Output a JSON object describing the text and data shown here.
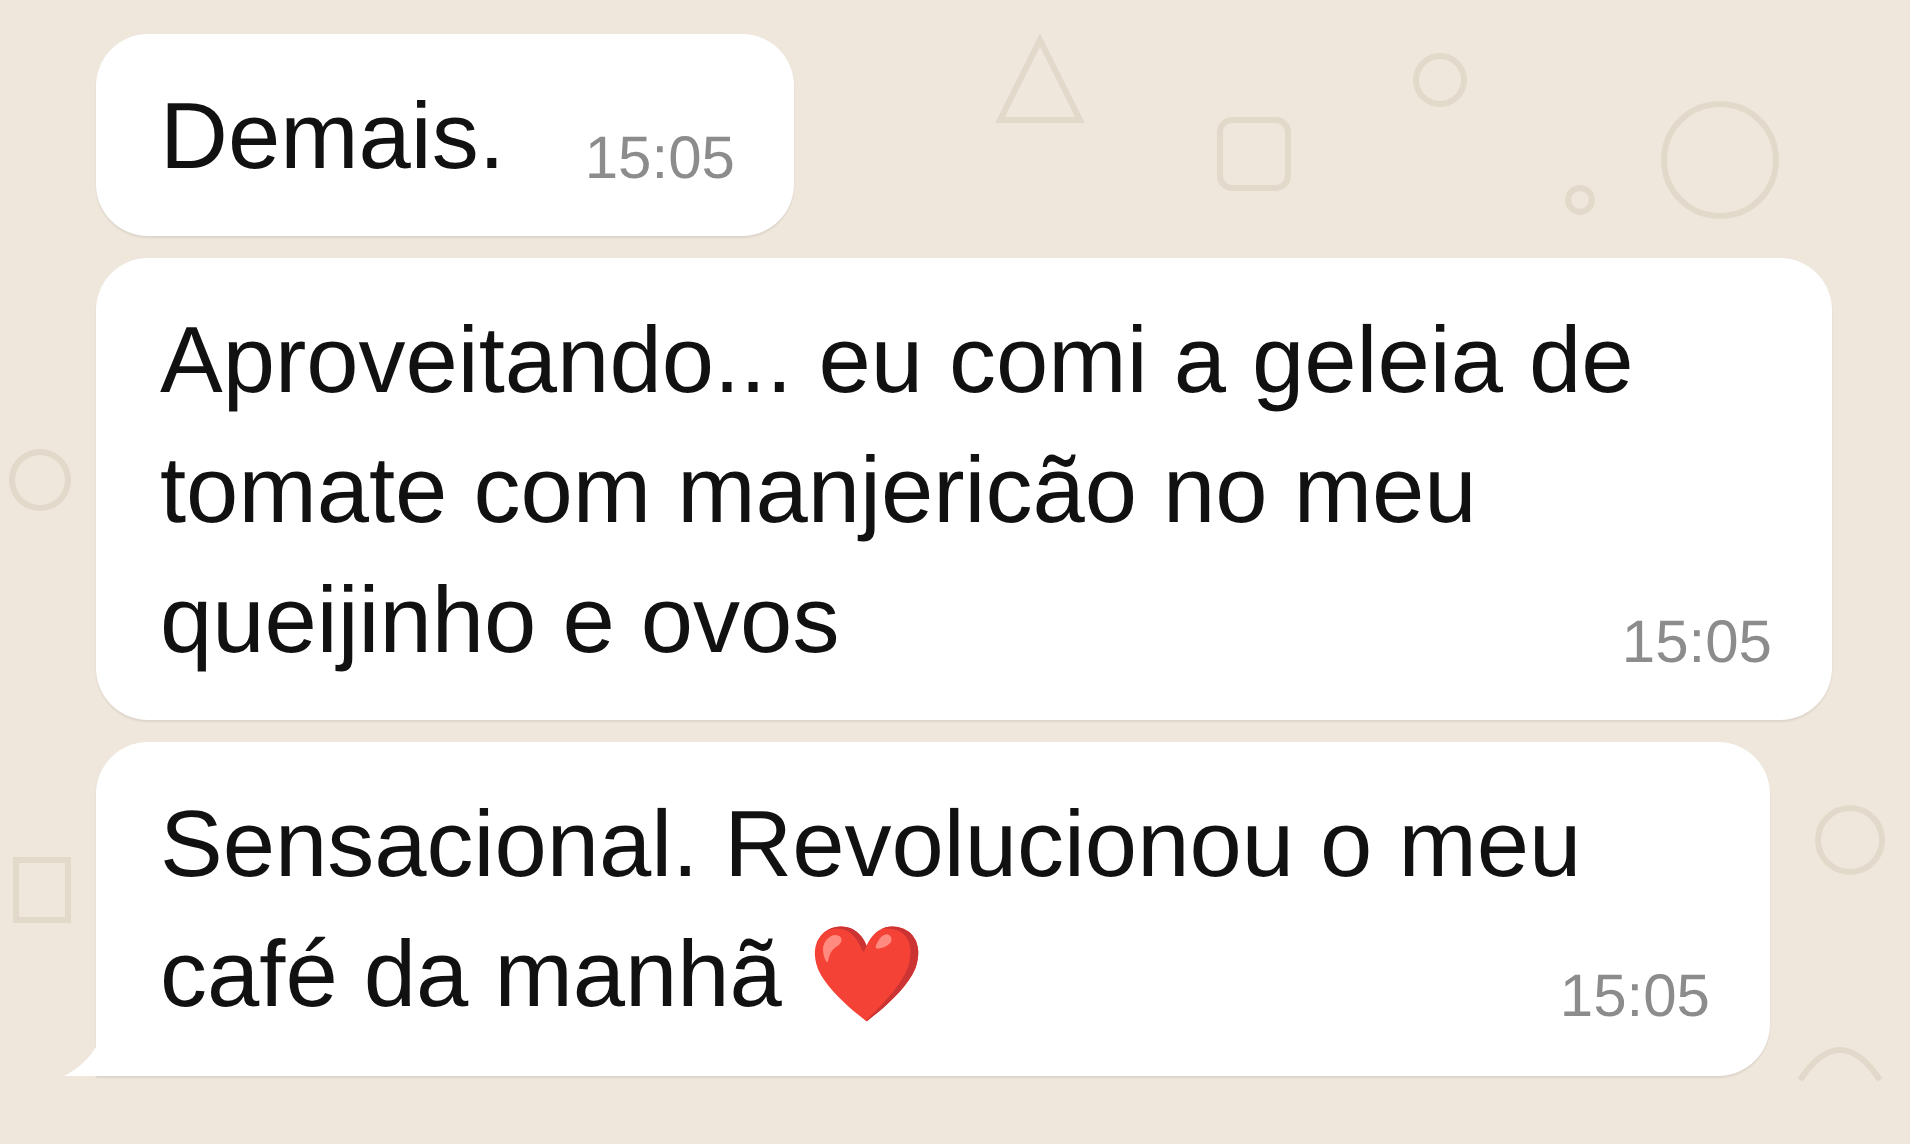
{
  "messages": [
    {
      "text": "Demais.",
      "time": "15:05",
      "tail": false
    },
    {
      "text": "Aproveitando... eu comi a geleia de tomate com manjericão no meu queijinho e ovos",
      "time": "15:05",
      "tail": false
    },
    {
      "text": "Sensacional. Revolucionou o meu café da manhã",
      "emoji": "❤️",
      "time": "15:05",
      "tail": true
    }
  ]
}
